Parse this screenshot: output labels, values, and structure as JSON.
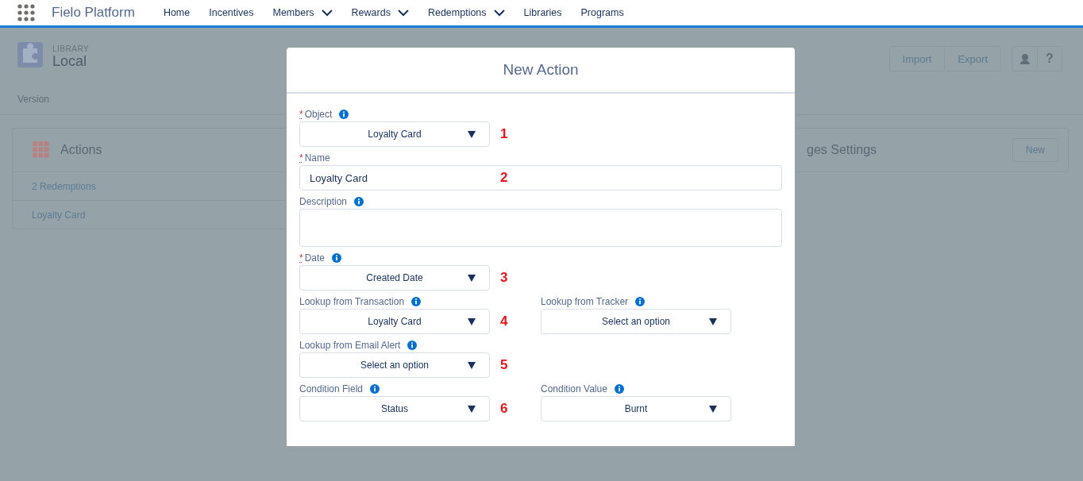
{
  "nav": {
    "app_name": "Fielo Platform",
    "items": [
      {
        "label": "Home",
        "has_menu": false
      },
      {
        "label": "Incentives",
        "has_menu": false
      },
      {
        "label": "Members",
        "has_menu": true
      },
      {
        "label": "Rewards",
        "has_menu": true
      },
      {
        "label": "Redemptions",
        "has_menu": true
      },
      {
        "label": "Libraries",
        "has_menu": false
      },
      {
        "label": "Programs",
        "has_menu": false
      }
    ]
  },
  "page": {
    "header": {
      "eyebrow": "LIBRARY",
      "title": "Local",
      "buttons": [
        "Import",
        "Export"
      ],
      "help_label": "?"
    },
    "version_label": "Version",
    "cards": [
      {
        "title": "Actions",
        "items": [
          "2 Redemptions",
          "Loyalty Card"
        ]
      },
      {
        "title": "ges Settings",
        "button": "New"
      }
    ]
  },
  "modal": {
    "title": "New Action",
    "required_symbol": "*",
    "rows": [
      {
        "marker": "1",
        "fields": [
          {
            "kind": "select",
            "label": "Object",
            "required": true,
            "info": true,
            "value": "Loyalty Card"
          }
        ]
      },
      {
        "marker": "2",
        "fields": [
          {
            "kind": "text",
            "label": "Name",
            "required": true,
            "info": false,
            "value": "Loyalty Card"
          }
        ]
      },
      {
        "fields": [
          {
            "kind": "textarea",
            "label": "Description",
            "required": false,
            "info": true
          }
        ]
      },
      {
        "marker": "3",
        "fields": [
          {
            "kind": "select",
            "label": "Date",
            "required": true,
            "info": true,
            "value": "Created Date"
          }
        ]
      },
      {
        "marker": "4",
        "fields": [
          {
            "kind": "select",
            "label": "Lookup from Transaction",
            "required": false,
            "info": true,
            "value": "Loyalty Card"
          },
          {
            "kind": "select",
            "label": "Lookup from Tracker",
            "required": false,
            "info": true,
            "value": "Select an option"
          }
        ]
      },
      {
        "marker": "5",
        "fields": [
          {
            "kind": "select",
            "label": "Lookup from Email Alert",
            "required": false,
            "info": true,
            "value": "Select an option"
          }
        ]
      },
      {
        "marker": "6",
        "fields": [
          {
            "kind": "select",
            "label": "Condition Field",
            "required": false,
            "info": true,
            "value": "Status"
          },
          {
            "kind": "select",
            "label": "Condition Value",
            "required": false,
            "info": true,
            "value": "Burnt"
          }
        ]
      }
    ]
  }
}
